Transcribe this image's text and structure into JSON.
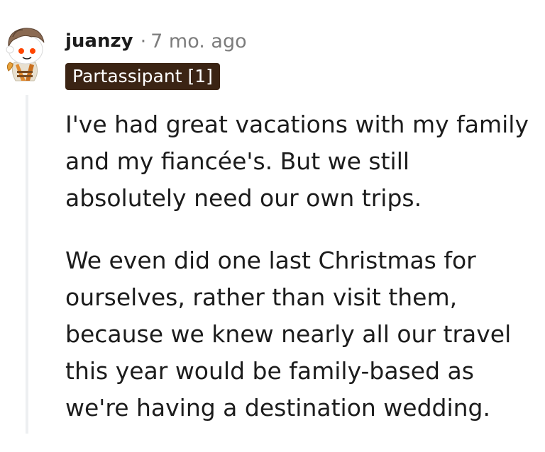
{
  "comment": {
    "author": "juanzy",
    "separator": "·",
    "age": "7 mo. ago",
    "flair": "Partassipant [1]",
    "paragraphs": [
      "I've had great vacations with my family and my fiancée's. But we still absolutely need our own trips.",
      "We even did one last Christmas for ourselves, rather than visit them, because we knew nearly all our travel this year would be family-based as we're having a destination wedding."
    ]
  },
  "icons": {
    "avatar": "reddit-snoo-avatar-icon"
  },
  "colors": {
    "flair_background": "#3b2414",
    "flair_text": "#ffffff",
    "meta_text": "#7c7c7c",
    "thread_line": "#edeff1"
  }
}
